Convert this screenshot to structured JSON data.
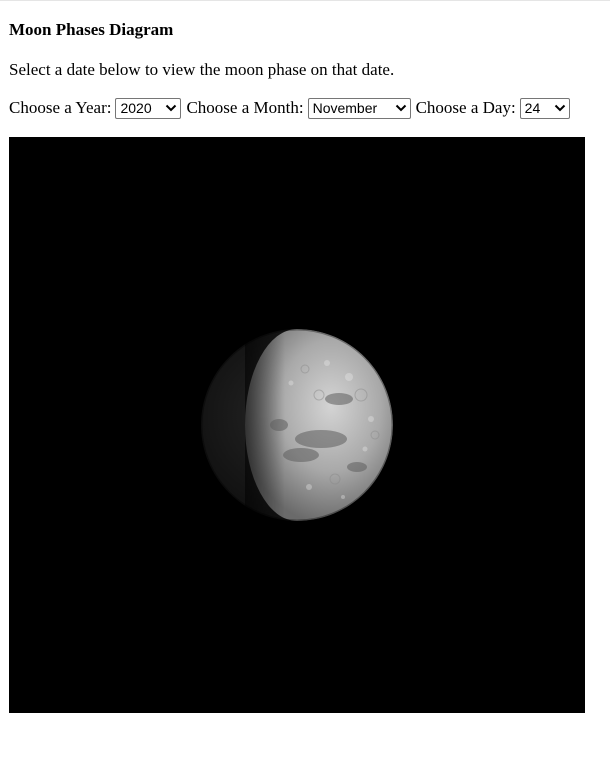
{
  "page": {
    "title": "Moon Phases Diagram",
    "intro": "Select a date below to view the moon phase on that date."
  },
  "controls": {
    "year_label": "Choose a Year:",
    "year_value": "2020",
    "month_label": "Choose a Month:",
    "month_value": "November",
    "day_label": "Choose a Day:",
    "day_value": "24"
  },
  "moon": {
    "phase": "waxing gibbous",
    "illuminated_side": "right",
    "background_color": "#000000",
    "lit_color": "#c8c8c8",
    "shadow_color": "#1a1a1a"
  },
  "icons": {
    "dropdown": "chevron-down-icon"
  }
}
